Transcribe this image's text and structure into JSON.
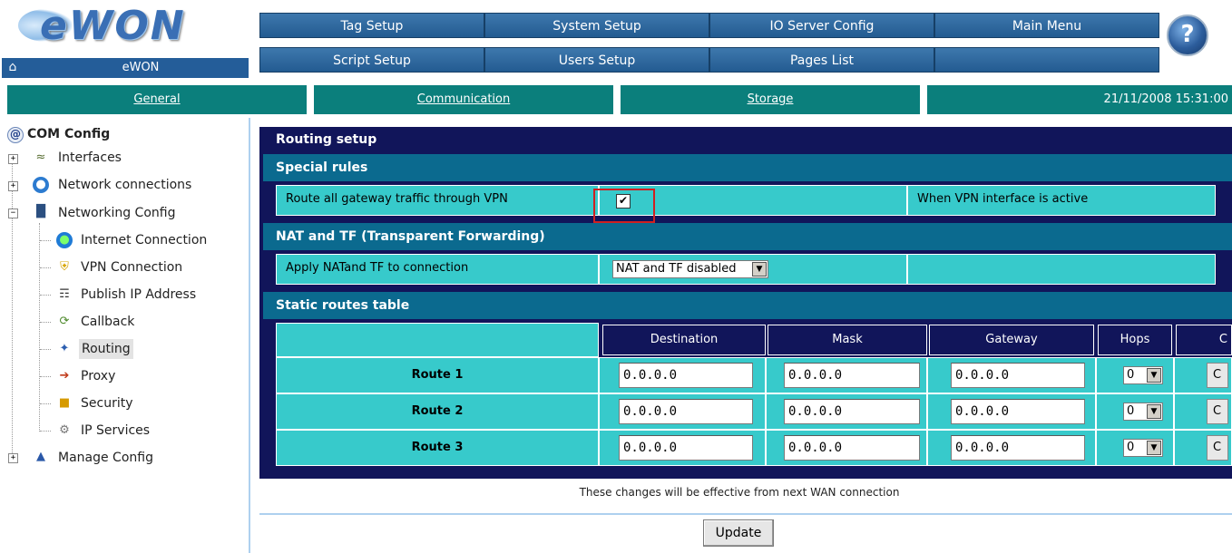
{
  "logo": {
    "text": "eWON"
  },
  "home": {
    "label": "eWON"
  },
  "top_menu": {
    "row1": [
      "Tag Setup",
      "System Setup",
      "IO Server Config",
      "Main Menu"
    ],
    "row2": [
      "Script Setup",
      "Users Setup",
      "Pages List",
      ""
    ],
    "help_glyph": "?"
  },
  "nav": {
    "tabs": [
      "General",
      "Communication",
      "Storage"
    ],
    "datetime": "21/11/2008 15:31:00"
  },
  "tree": {
    "root": "COM Config",
    "items": [
      {
        "label": "Interfaces",
        "icon": "network-cable-icon",
        "level": 0,
        "expandable": true
      },
      {
        "label": "Network connections",
        "icon": "globe-network-icon",
        "level": 0,
        "expandable": true
      },
      {
        "label": "Networking Config",
        "icon": "computer-icon",
        "level": 0,
        "expandable": true,
        "expanded": true
      },
      {
        "label": "Internet Connection",
        "icon": "internet-icon",
        "level": 1
      },
      {
        "label": "VPN Connection",
        "icon": "vpn-shield-icon",
        "level": 1
      },
      {
        "label": "Publish IP Address",
        "icon": "publish-icon",
        "level": 1
      },
      {
        "label": "Callback",
        "icon": "callback-icon",
        "level": 1
      },
      {
        "label": "Routing",
        "icon": "routing-icon",
        "level": 1,
        "selected": true
      },
      {
        "label": "Proxy",
        "icon": "proxy-icon",
        "level": 1
      },
      {
        "label": "Security",
        "icon": "lock-icon",
        "level": 1
      },
      {
        "label": "IP Services",
        "icon": "gear-icon",
        "level": 1
      },
      {
        "label": "Manage Config",
        "icon": "manage-icon",
        "level": 0,
        "expandable": true
      }
    ]
  },
  "routing": {
    "title": "Routing setup",
    "special_rules": {
      "header": "Special rules",
      "vpn_label": "Route all gateway traffic through VPN",
      "vpn_checked": true,
      "vpn_note": "When VPN interface is active",
      "check_glyph": "✔"
    },
    "nat": {
      "header": "NAT and TF (Transparent Forwarding)",
      "label": "Apply NATand TF to connection",
      "selected": "NAT and TF disabled"
    },
    "static_routes": {
      "header": "Static routes table",
      "columns": [
        "Destination",
        "Mask",
        "Gateway",
        "Hops",
        "C"
      ],
      "rows": [
        {
          "name": "Route 1",
          "destination": "0.0.0.0",
          "mask": "0.0.0.0",
          "gateway": "0.0.0.0",
          "hops": "0"
        },
        {
          "name": "Route 2",
          "destination": "0.0.0.0",
          "mask": "0.0.0.0",
          "gateway": "0.0.0.0",
          "hops": "0"
        },
        {
          "name": "Route 3",
          "destination": "0.0.0.0",
          "mask": "0.0.0.0",
          "gateway": "0.0.0.0",
          "hops": "0"
        }
      ],
      "trailing_button_glyph": "C"
    },
    "footer_note": "These changes will be effective from next WAN connection",
    "update_label": "Update",
    "dropdown_arrow": "▼"
  },
  "colors": {
    "panel_navy": "#11155a",
    "section_blue": "#0b6a8f",
    "cell_teal": "#37cacb",
    "nav_teal": "#0b7f7c",
    "highlight_red": "#d02020"
  }
}
